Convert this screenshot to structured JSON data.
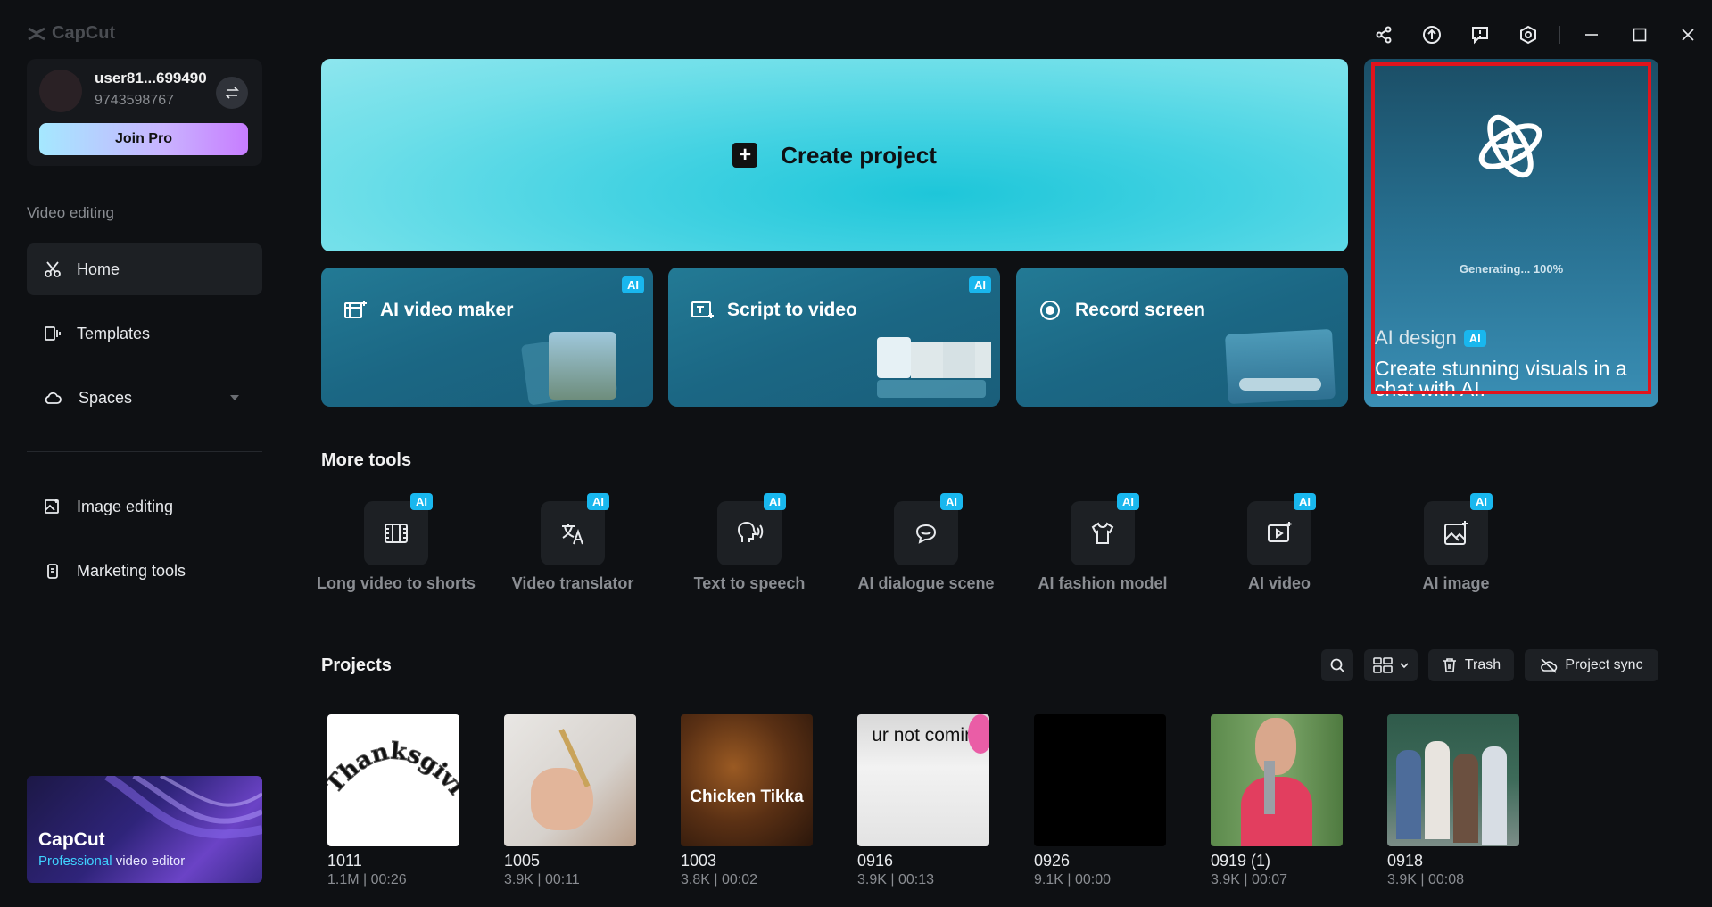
{
  "app": {
    "logo_text": "CapCut"
  },
  "user": {
    "name": "user81...699490",
    "id": "9743598767",
    "join_label": "Join Pro"
  },
  "sidebar": {
    "section_label": "Video editing",
    "items": [
      {
        "label": "Home",
        "icon": "scissors-icon",
        "active": true
      },
      {
        "label": "Templates",
        "icon": "templates-icon"
      },
      {
        "label": "Spaces",
        "icon": "cloud-icon"
      },
      {
        "label": "Image editing",
        "icon": "image-edit-icon"
      },
      {
        "label": "Marketing tools",
        "icon": "marketing-icon"
      }
    ],
    "promo": {
      "title": "CapCut",
      "sub_highlight": "Professional",
      "sub_rest": " video editor"
    }
  },
  "create_project": {
    "label": "Create project"
  },
  "cards": [
    {
      "label": "AI video maker",
      "badge": "AI"
    },
    {
      "label": "Script to video",
      "badge": "AI"
    },
    {
      "label": "Record screen"
    }
  ],
  "ai_design": {
    "generating": "Generating... 100%",
    "title": "AI design",
    "badge": "AI",
    "description": "Create stunning visuals in a chat with AI."
  },
  "more_tools": {
    "heading": "More tools",
    "items": [
      {
        "label": "Long video to shorts",
        "badge": "AI"
      },
      {
        "label": "Video translator",
        "badge": "AI"
      },
      {
        "label": "Text to speech",
        "badge": "AI"
      },
      {
        "label": "AI dialogue scene",
        "badge": "AI"
      },
      {
        "label": "AI fashion model",
        "badge": "AI"
      },
      {
        "label": "AI video",
        "badge": "AI"
      },
      {
        "label": "AI image",
        "badge": "AI"
      }
    ]
  },
  "projects": {
    "heading": "Projects",
    "trash_label": "Trash",
    "sync_label": "Project sync",
    "items": [
      {
        "name": "1011",
        "meta": "1.1M | 00:26",
        "thumb_text": "Thanksgiving"
      },
      {
        "name": "1005",
        "meta": "3.9K | 00:11"
      },
      {
        "name": "1003",
        "meta": "3.8K | 00:02",
        "thumb_text": "Chicken Tikka"
      },
      {
        "name": "0916",
        "meta": "3.9K | 00:13",
        "thumb_text": "ur not comin"
      },
      {
        "name": "0926",
        "meta": "9.1K | 00:00"
      },
      {
        "name": "0919 (1)",
        "meta": "3.9K | 00:07"
      },
      {
        "name": "0918",
        "meta": "3.9K | 00:08"
      }
    ]
  },
  "colors": {
    "accent": "#19b7ee",
    "background": "#0e1013",
    "highlight": "#e0141c"
  }
}
